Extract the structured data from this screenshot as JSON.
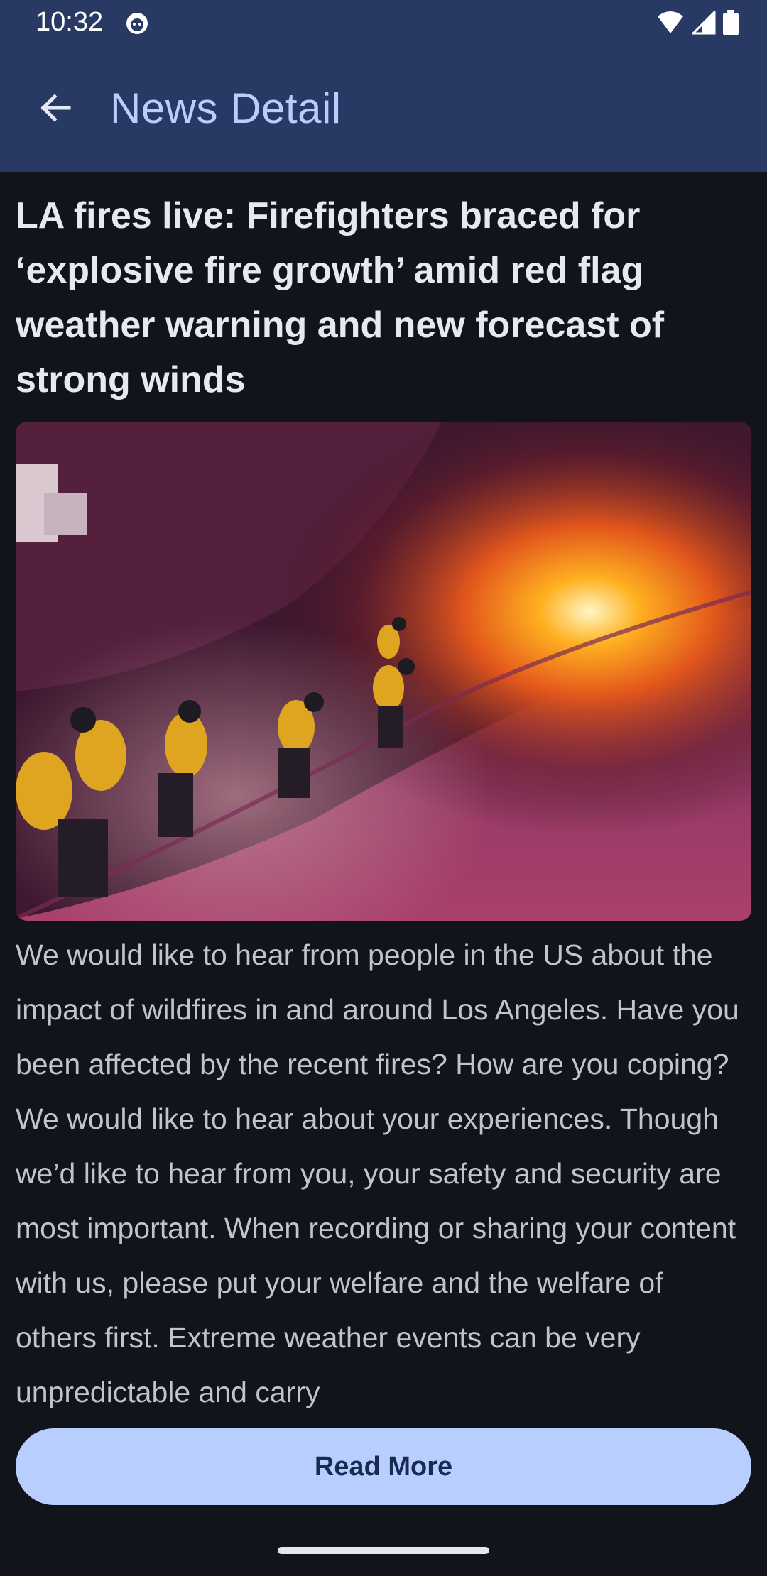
{
  "status_bar": {
    "time": "10:32",
    "icons": [
      "app-notification-icon",
      "wifi-icon",
      "signal-icon",
      "battery-icon"
    ]
  },
  "app_bar": {
    "back_icon": "arrow-back-icon",
    "title": "News Detail"
  },
  "article": {
    "headline": "LA fires live: Firefighters braced for ‘explosive fire growth’ amid red flag weather warning and new forecast of strong winds",
    "body": "We would like to hear from people in the US about the impact of wildfires in and around Los Angeles. Have you been affected by the recent fires? How are you coping? We would like to hear about your experiences. Though we’d like to hear from you, your safety and security are most important. When recording or sharing your content with us, please put your welfare and the welfare of others first. Extreme weather events can be very unpredictable and carry"
  },
  "actions": {
    "read_more_label": "Read More"
  },
  "colors": {
    "app_bar": "#283a63",
    "background": "#11141b",
    "accent": "#b8ceff"
  }
}
